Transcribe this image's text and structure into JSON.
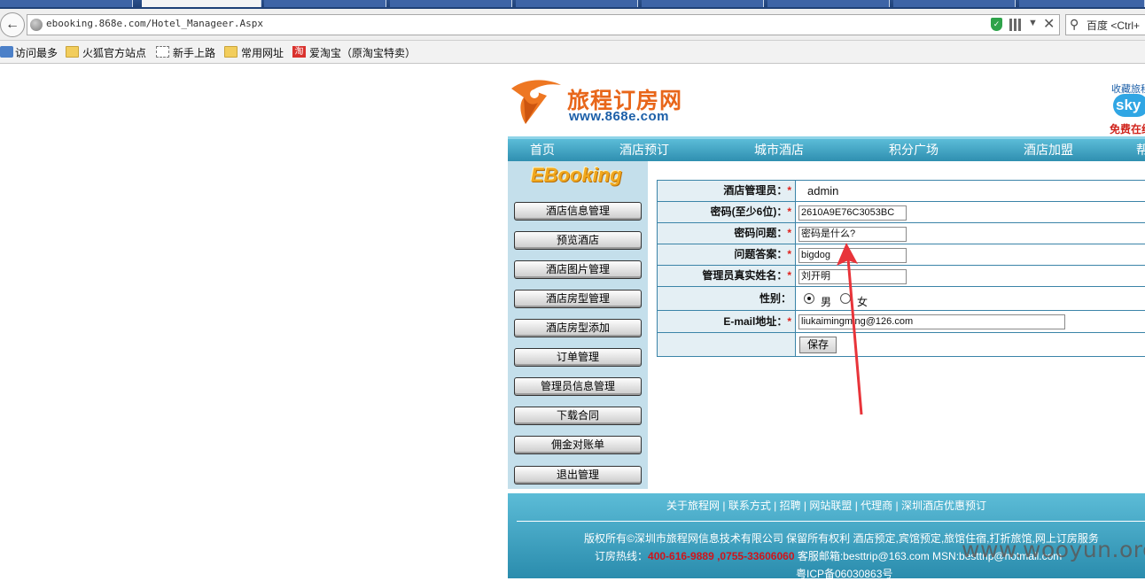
{
  "browser": {
    "url": "ebooking.868e.com/Hotel_Manageer.Aspx",
    "search_placeholder": "百度 <Ctrl+",
    "bookmarks": [
      "访问最多",
      "火狐官方站点",
      "新手上路",
      "常用网址",
      "爱淘宝（原淘宝特卖）"
    ]
  },
  "site": {
    "logo_title": "旅程订房网",
    "logo_url": "www.868e.com",
    "fav_text": "收藏旅程",
    "skype_label": "sky",
    "free_text": "免费在线",
    "nav": [
      "首页",
      "酒店预订",
      "城市酒店",
      "积分广场",
      "酒店加盟",
      "帮"
    ]
  },
  "sidebar": {
    "logo": "EBooking",
    "items": [
      "酒店信息管理",
      "预览酒店",
      "酒店图片管理",
      "酒店房型管理",
      "酒店房型添加",
      "订单管理",
      "管理员信息管理",
      "下载合同",
      "佣金对账单",
      "退出管理"
    ]
  },
  "form": {
    "rows": [
      {
        "label": "酒店管理员：",
        "required": "*",
        "value": "admin"
      },
      {
        "label": "密码(至少6位)：",
        "required": "*",
        "value": "2610A9E76C3053BC"
      },
      {
        "label": "密码问题：",
        "required": "*",
        "value": "密码是什么?"
      },
      {
        "label": "问题答案：",
        "required": "*",
        "value": "bigdog"
      },
      {
        "label": "管理员真实姓名：",
        "required": "*",
        "value": "刘开明"
      },
      {
        "label": "性别：",
        "required": "",
        "value": ""
      },
      {
        "label": "E-mail地址：",
        "required": "*",
        "value": "liukaimingming@126.com"
      }
    ],
    "gender_options": [
      "男",
      "女"
    ],
    "gender_selected": "男",
    "save_label": "保存"
  },
  "footer": {
    "links": "关于旅程网 | 联系方式 | 招聘 | 网站联盟 | 代理商 | 深圳酒店优惠预订",
    "copyright": "版权所有©深圳市旅程网信息技术有限公司 保留所有权利   酒店预定,宾馆预定,旅馆住宿,打折旅馆,网上订房服务",
    "hotline_label": "订房热线：",
    "hotline_numbers": "400-616-9889 ,0755-33606060",
    "service_email": " 客服邮箱:besttrip@163.com MSN:besttrip@hotmail.com",
    "icp": "粤ICP备06030863号"
  },
  "watermark": "www.wooyun.org",
  "colors": {
    "nav_blue": "#3a9cbe",
    "sidebar_bg": "#c4dfeb",
    "accent_orange": "#e8661a",
    "required_red": "#e0201a",
    "arrow_red": "#e8343a"
  }
}
